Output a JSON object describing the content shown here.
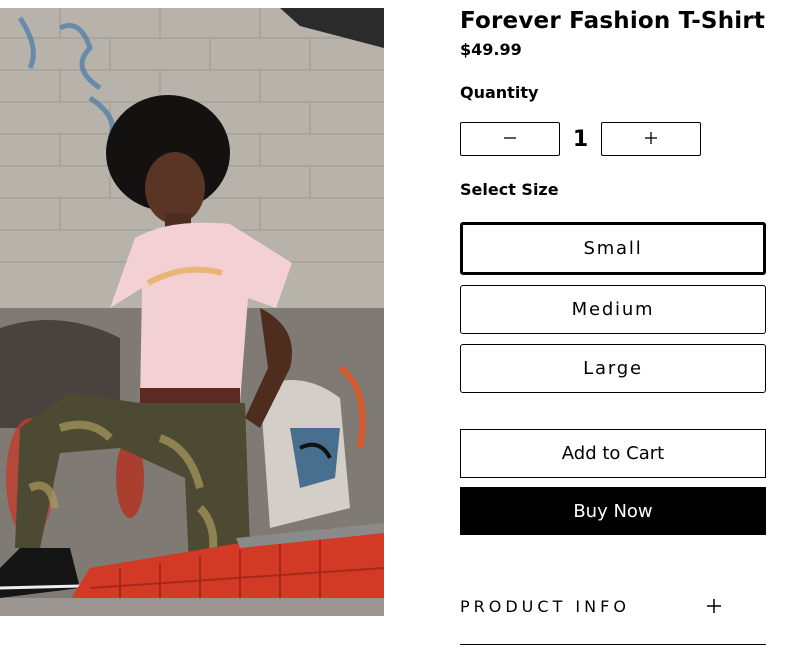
{
  "product": {
    "title": "Forever Fashion T-Shirt",
    "price": "$49.99",
    "image_icon": "product-photo"
  },
  "quantity": {
    "label": "Quantity",
    "value": "1",
    "decrement_icon": "minus-icon",
    "increment_icon": "plus-icon"
  },
  "size": {
    "label": "Select Size",
    "options": [
      "Small",
      "Medium",
      "Large"
    ],
    "selected": "Small"
  },
  "actions": {
    "add_to_cart": "Add to Cart",
    "buy_now": "Buy Now"
  },
  "accordion": {
    "product_info_label": "PRODUCT INFO",
    "expand_icon": "plus-icon"
  },
  "colors": {
    "primary": "#000000",
    "background": "#ffffff",
    "selected_border": "#000000"
  }
}
